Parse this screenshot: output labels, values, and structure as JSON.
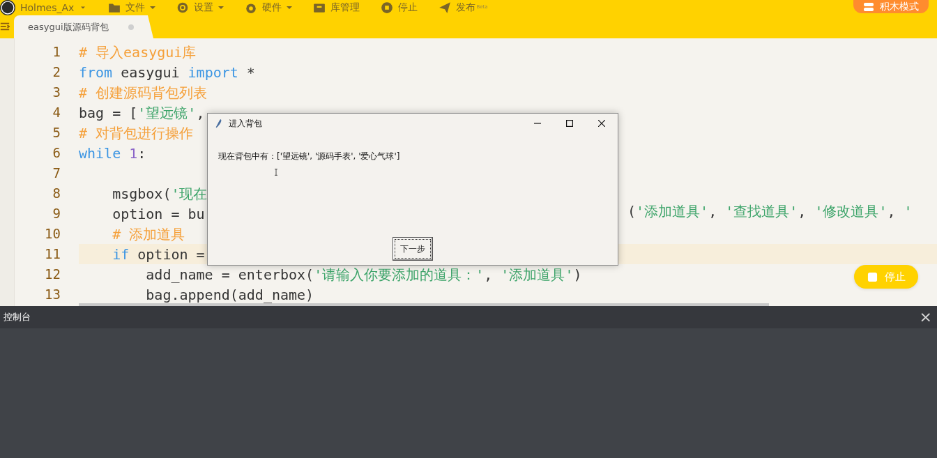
{
  "toolbar": {
    "user": {
      "name": "Holmes_Ax"
    },
    "menus": [
      {
        "label": "文件",
        "dropdown": true
      },
      {
        "label": "设置",
        "dropdown": true
      },
      {
        "label": "硬件",
        "dropdown": true
      },
      {
        "label": "库管理",
        "dropdown": false
      },
      {
        "label": "停止",
        "dropdown": false
      },
      {
        "label": "发布",
        "dropdown": false,
        "badge": "Beta"
      }
    ],
    "mode_button": {
      "label": "积木模式"
    }
  },
  "tabs": [
    {
      "label": "easygui版源码背包",
      "selected": true,
      "modified": true
    }
  ],
  "editor": {
    "lines": [
      {
        "number": "1",
        "current": false,
        "segments": [
          {
            "kind": "left",
            "tokens": [
              {
                "kind": "comment",
                "text": "# 导入easygui库"
              }
            ]
          }
        ]
      },
      {
        "number": "2",
        "current": false,
        "segments": [
          {
            "kind": "left",
            "tokens": [
              {
                "kind": "keyword",
                "text": "from"
              },
              {
                "kind": "plain",
                "text": " easygui "
              },
              {
                "kind": "keyword",
                "text": "import"
              },
              {
                "kind": "plain",
                "text": " *"
              }
            ]
          }
        ]
      },
      {
        "number": "3",
        "current": false,
        "segments": [
          {
            "kind": "left",
            "tokens": [
              {
                "kind": "comment",
                "text": "# 创建源码背包列表"
              }
            ]
          }
        ]
      },
      {
        "number": "4",
        "current": false,
        "segments": [
          {
            "kind": "left",
            "tokens": [
              {
                "kind": "plain",
                "text": "bag = ["
              },
              {
                "kind": "string",
                "text": "'望远镜'"
              },
              {
                "kind": "plain",
                "text": ","
              }
            ]
          }
        ]
      },
      {
        "number": "5",
        "current": false,
        "segments": [
          {
            "kind": "left",
            "tokens": [
              {
                "kind": "comment",
                "text": "# 对背包进行操作"
              }
            ]
          }
        ]
      },
      {
        "number": "6",
        "current": false,
        "segments": [
          {
            "kind": "left",
            "tokens": [
              {
                "kind": "keyword",
                "text": "while "
              },
              {
                "kind": "number",
                "text": "1"
              },
              {
                "kind": "plain",
                "text": ":"
              }
            ]
          }
        ]
      },
      {
        "number": "7",
        "current": false
      },
      {
        "number": "8",
        "current": false,
        "segments": [
          {
            "kind": "left",
            "tokens": [
              {
                "kind": "plain",
                "text": "    msgbox("
              },
              {
                "kind": "string",
                "text": "'现在"
              }
            ]
          }
        ]
      },
      {
        "number": "9",
        "current": false,
        "segments": [
          {
            "kind": "left",
            "tokens": [
              {
                "kind": "plain",
                "text": "    option = bu"
              }
            ]
          },
          {
            "kind": "right",
            "tokens": [
              {
                "kind": "plain",
                "text": "("
              },
              {
                "kind": "string",
                "text": "'添加道具'"
              },
              {
                "kind": "plain",
                "text": ", "
              },
              {
                "kind": "string",
                "text": "'查找道具'"
              },
              {
                "kind": "plain",
                "text": ", "
              },
              {
                "kind": "string",
                "text": "'修改道具'"
              },
              {
                "kind": "plain",
                "text": ", "
              },
              {
                "kind": "string",
                "text": "'"
              }
            ]
          }
        ]
      },
      {
        "number": "10",
        "current": false,
        "segments": [
          {
            "kind": "left",
            "tokens": [
              {
                "kind": "comment",
                "text": "    # 添加道具"
              }
            ]
          }
        ]
      },
      {
        "number": "11",
        "current": true,
        "segments": [
          {
            "kind": "left",
            "tokens": [
              {
                "kind": "keyword",
                "text": "    if"
              },
              {
                "kind": "plain",
                "text": " option ="
              }
            ]
          }
        ]
      },
      {
        "number": "12",
        "current": false,
        "segments": [
          {
            "kind": "left",
            "tokens": [
              {
                "kind": "plain",
                "text": "        add_name = enterbox("
              },
              {
                "kind": "string",
                "text": "'请输入你要添加的道具：'"
              },
              {
                "kind": "plain",
                "text": ", "
              },
              {
                "kind": "string",
                "text": "'添加道具'"
              },
              {
                "kind": "plain",
                "text": ")"
              }
            ]
          }
        ]
      },
      {
        "number": "13",
        "current": false,
        "segments": [
          {
            "kind": "left",
            "tokens": [
              {
                "kind": "plain",
                "text": "        bag.append(add_name)"
              }
            ]
          }
        ]
      }
    ]
  },
  "dialog": {
    "title": "进入背包",
    "message": "现在背包中有：['望远镜', '源码手表', '爱心气球']",
    "button": "下一步"
  },
  "stop_button": {
    "label": "停止"
  },
  "console": {
    "title": "控制台",
    "close": "×"
  }
}
